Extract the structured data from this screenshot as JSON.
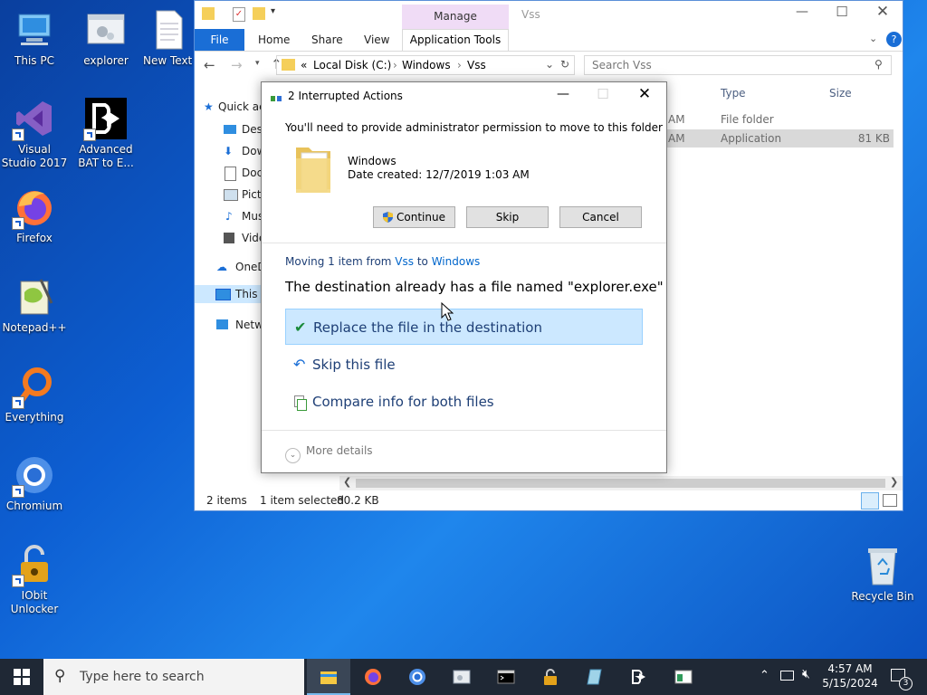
{
  "desktop": {
    "icons": [
      {
        "label": "This PC"
      },
      {
        "label": "explorer"
      },
      {
        "label": "New Text Document"
      },
      {
        "label": "Visual Studio 2017"
      },
      {
        "label": "Advanced BAT to E..."
      },
      {
        "label": "Firefox"
      },
      {
        "label": "Notepad++"
      },
      {
        "label": "Everything"
      },
      {
        "label": "Chromium"
      },
      {
        "label": "IObit Unlocker"
      },
      {
        "label": "Recycle Bin"
      }
    ]
  },
  "explorer": {
    "title": "Vss",
    "ribbon": {
      "contextual_group": "Manage",
      "tabs": [
        "File",
        "Home",
        "Share",
        "View",
        "Application Tools"
      ]
    },
    "address": {
      "path": [
        "Local Disk (C:)",
        "Windows",
        "Vss"
      ],
      "prefix": "«"
    },
    "search": {
      "placeholder": "Search Vss"
    },
    "nav_items": [
      "Quick access",
      "Desktop",
      "Downloads",
      "Documents",
      "Pictures",
      "Music",
      "Videos",
      "OneDrive",
      "This PC",
      "Network"
    ],
    "columns": {
      "type": "Type",
      "size": "Size"
    },
    "rows": [
      {
        "date_fragment": "AM",
        "type": "File folder",
        "size": ""
      },
      {
        "date_fragment": "AM",
        "type": "Application",
        "size": "81 KB"
      }
    ],
    "status": {
      "items": "2 items",
      "selected": "1 item selected",
      "size": "80.2 KB"
    }
  },
  "dialog": {
    "title": "2 Interrupted Actions",
    "permission_message": "You'll need to provide administrator permission to move to this folder",
    "folder": {
      "name": "Windows",
      "date_created": "Date created: 12/7/2019 1:03 AM"
    },
    "buttons": {
      "continue": "Continue",
      "skip": "Skip",
      "cancel": "Cancel"
    },
    "moving": {
      "prefix": "Moving 1 item from ",
      "from": "Vss",
      "to_word": " to ",
      "to": "Windows"
    },
    "conflict_message": "The destination already has a file named \"explorer.exe\"",
    "options": {
      "replace": "Replace the file in the destination",
      "skip": "Skip this file",
      "compare": "Compare info for both files"
    },
    "more_details": "More details"
  },
  "taskbar": {
    "search_placeholder": "Type here to search",
    "time": "4:57 AM",
    "date": "5/15/2024",
    "notification_count": "3"
  },
  "colors": {
    "accent": "#1a6ed6",
    "selection": "#cce8ff",
    "manage_tab": "#f0dcf6",
    "taskbar": "#1f2835"
  }
}
